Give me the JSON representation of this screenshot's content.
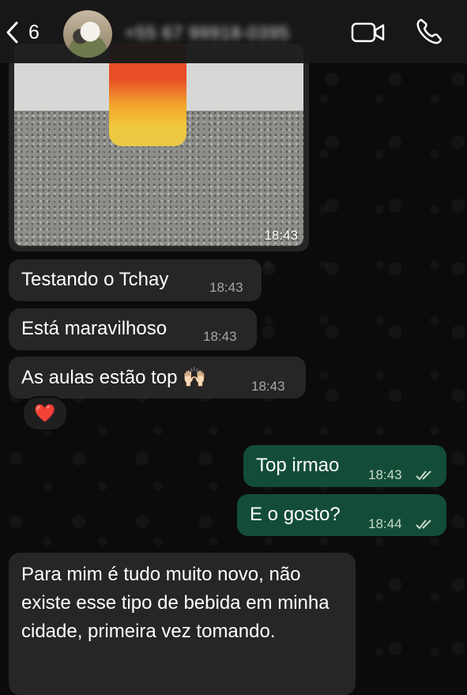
{
  "header": {
    "unread_count": "6",
    "contact": "+55 67 99918-0395",
    "icons": [
      "chevron-left-icon",
      "video-camera-icon",
      "phone-icon"
    ]
  },
  "messages": [
    {
      "type": "image",
      "direction": "in",
      "time": "18:43"
    },
    {
      "direction": "in",
      "text": "Testando o Tchay",
      "time": "18:43"
    },
    {
      "direction": "in",
      "text": "Está maravilhoso",
      "time": "18:43"
    },
    {
      "direction": "in",
      "text": "As aulas estão top 🙌🏻",
      "time": "18:43",
      "reaction": "❤️"
    },
    {
      "direction": "out",
      "text": "Top irmao",
      "time": "18:43",
      "status": "read"
    },
    {
      "direction": "out",
      "text": "E o gosto?",
      "time": "18:44",
      "status": "read"
    },
    {
      "direction": "in",
      "text": "Para mim é tudo muito novo, não existe esse tipo de bebida em minha cidade, primeira vez tomando."
    }
  ],
  "colors": {
    "background": "#0b0b0b",
    "incoming_bubble": "#262626",
    "outgoing_bubble": "#134d37",
    "reaction": "#e0142c"
  }
}
